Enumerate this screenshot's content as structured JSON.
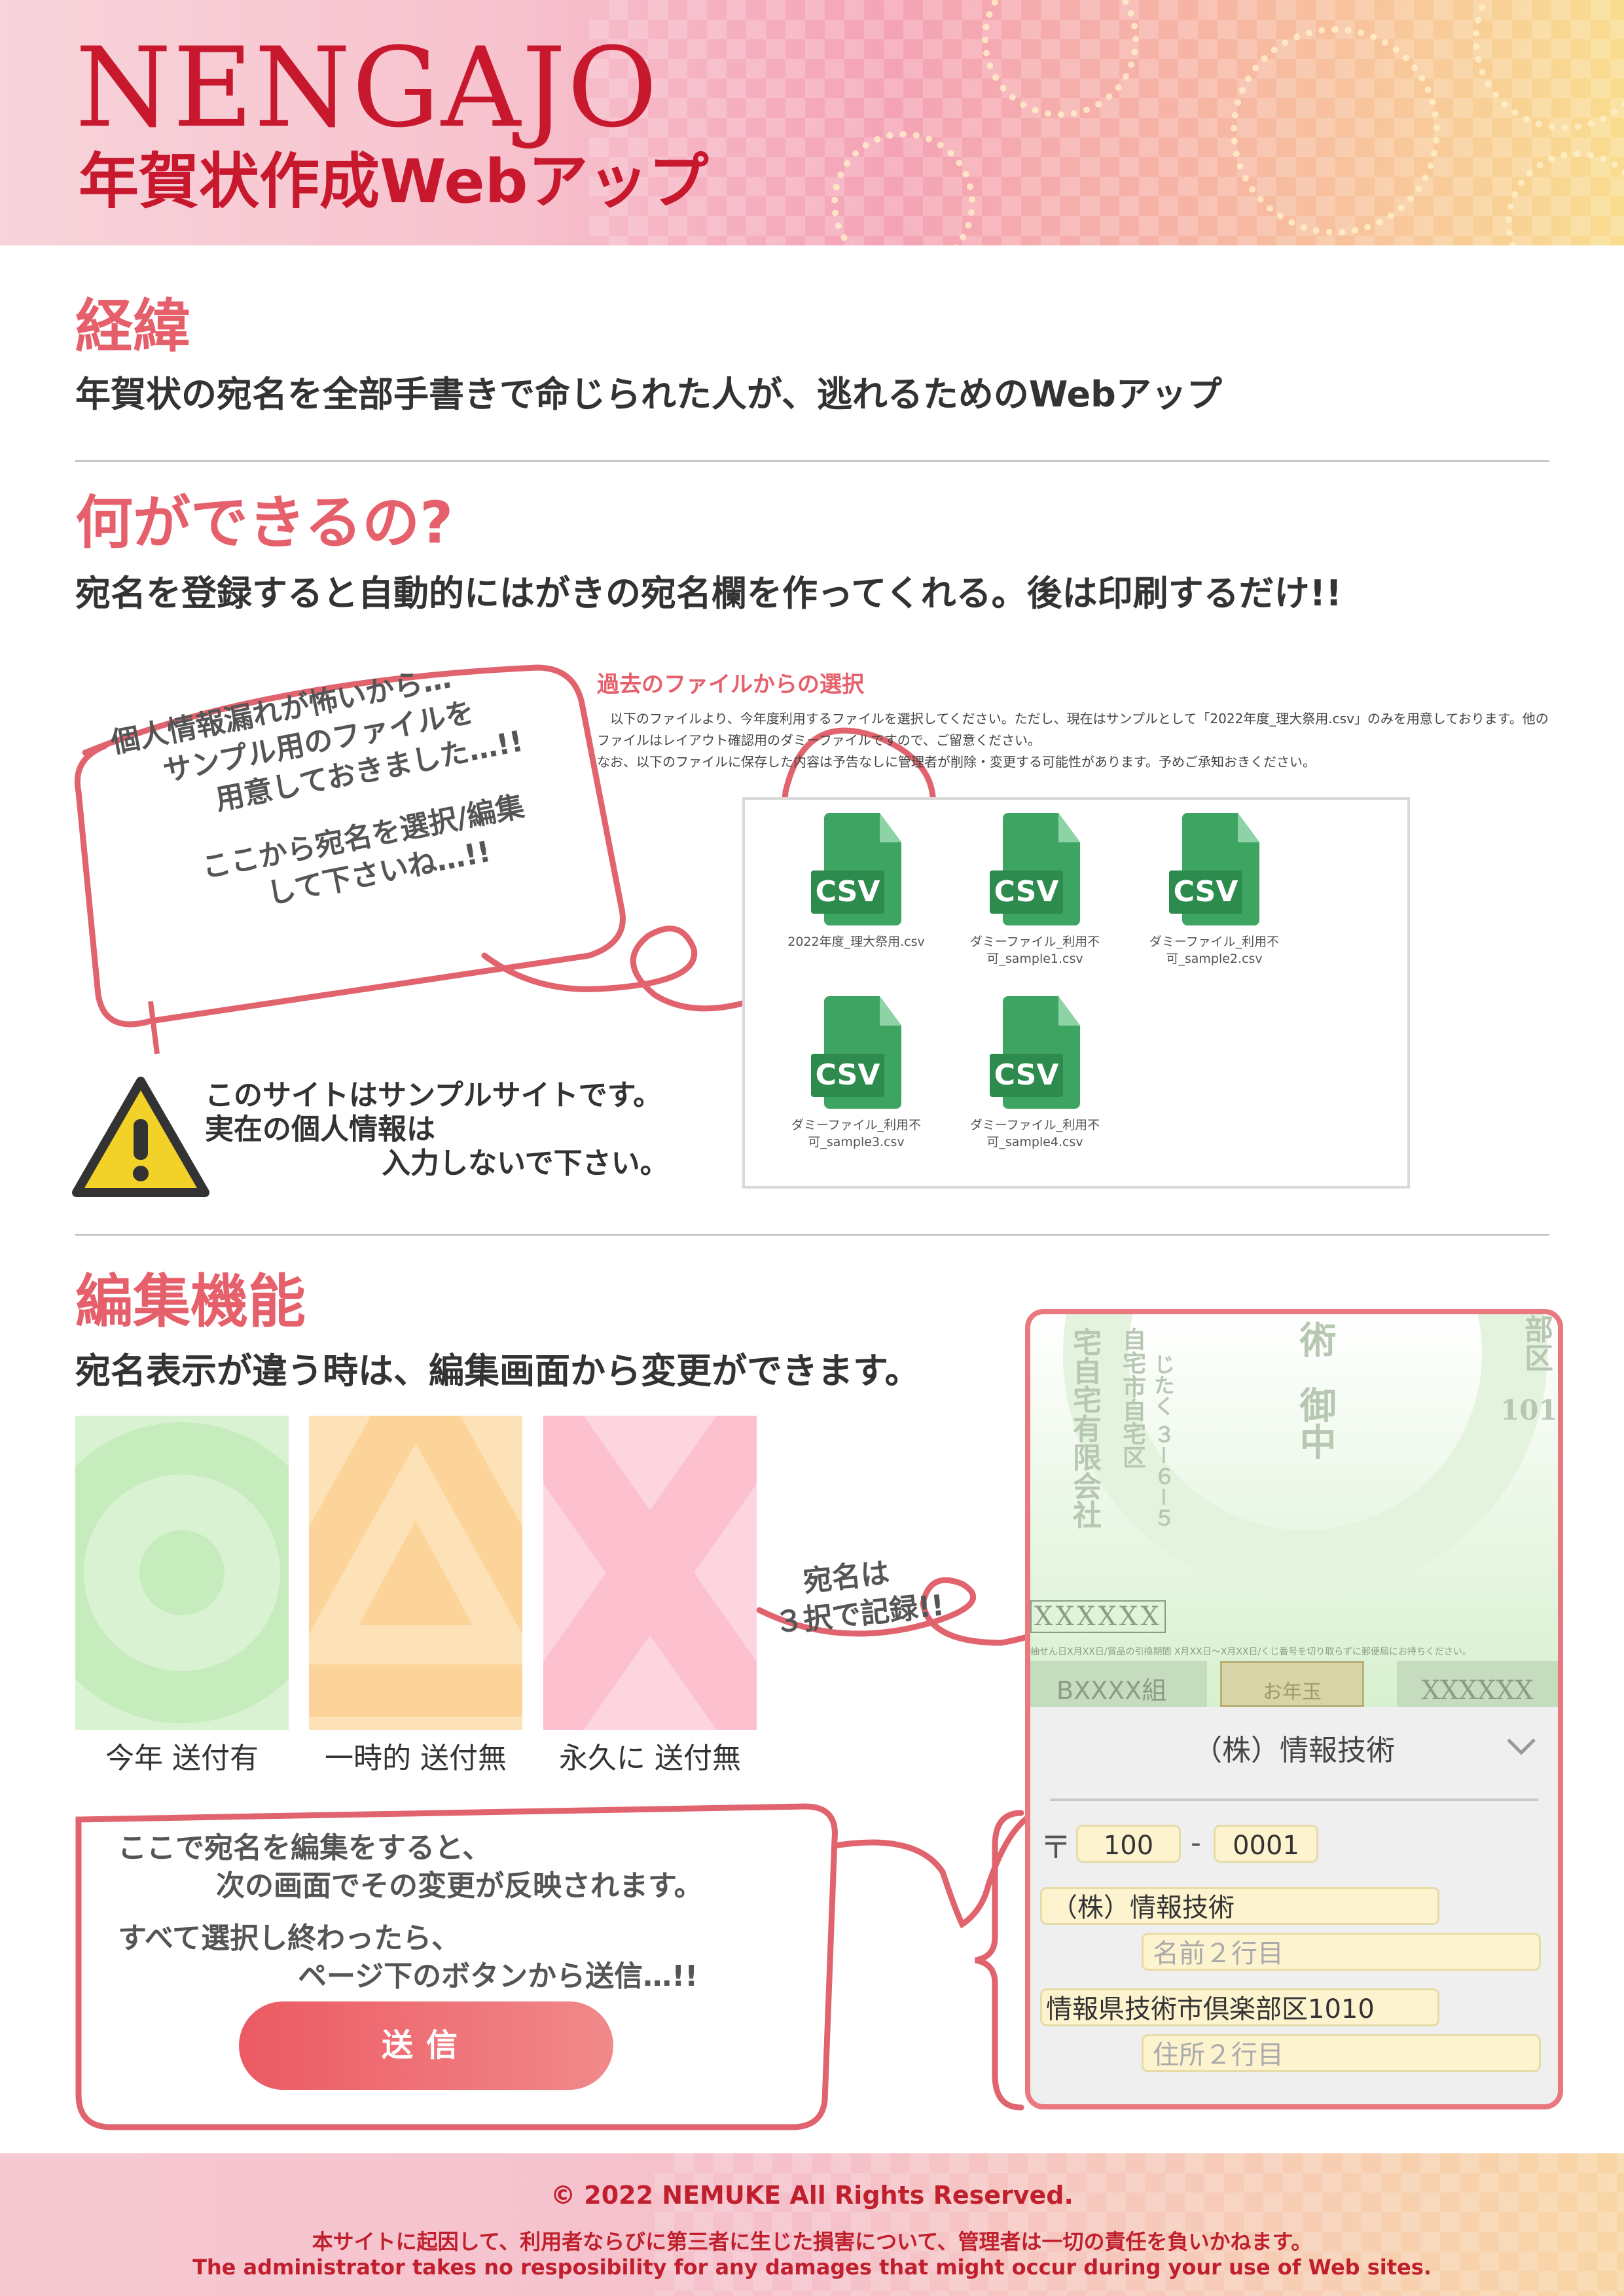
{
  "header": {
    "logo": "NENGAJO",
    "subtitle": "年賀状作成Webアップ"
  },
  "background": {
    "title": "経緯",
    "text": "年賀状の宛名を全部手書きで命じられた人が、逃れるためのWebアップ"
  },
  "features": {
    "title": "何ができるの?",
    "text": "宛名を登録すると自動的にはがきの宛名欄を作ってくれる。後は印刷するだけ!!"
  },
  "note1": {
    "line1": "個人情報漏れが怖いから…",
    "line2": "サンプル用のファイルを",
    "line3": "用意しておきました…!!",
    "line4": "ここから宛名を選択/編集",
    "line5": "して下さいね…!!"
  },
  "file_panel": {
    "title": "過去のファイルからの選択",
    "desc1": "　以下のファイルより、今年度利用するファイルを選択してください。ただし、現在はサンプルとして「2022年度_理大祭用.csv」のみを用意しております。他のファイルはレイアウト確認用のダミーファイルですので、ご留意ください。",
    "desc2": "なお、以下のファイルに保存した内容は予告なしに管理者が削除・変更する可能性があります。予めご承知おきください。",
    "icon_label": "CSV",
    "files": [
      {
        "name1": "2022年度_理大祭用.csv",
        "name2": ""
      },
      {
        "name1": "ダミーファイル_利用不",
        "name2": "可_sample1.csv"
      },
      {
        "name1": "ダミーファイル_利用不",
        "name2": "可_sample2.csv"
      },
      {
        "name1": "ダミーファイル_利用不",
        "name2": "可_sample3.csv"
      },
      {
        "name1": "ダミーファイル_利用不",
        "name2": "可_sample4.csv"
      }
    ]
  },
  "warning": {
    "line1": "このサイトはサンプルサイトです。",
    "line2": "実在の個人情報は",
    "line3": "入力しないで下さい。"
  },
  "edit": {
    "title": "編集機能",
    "text": "宛名表示が違う時は、編集画面から変更ができます。",
    "tiles": [
      "今年 送付有",
      "一時的 送付無",
      "永久に 送付無"
    ],
    "note_line1": "宛名は",
    "note_line2": "３択で記録!!"
  },
  "note2": {
    "line1": "ここで宛名を編集をすると、",
    "line2": "次の画面でその変更が反映されます。",
    "line3": "すべて選択し終わったら、",
    "line4": "ページ下のボタンから送信…!!"
  },
  "send_label": "送信",
  "phone": {
    "card_col1": "宅自宅有限会社",
    "card_col2": "自宅市自宅区",
    "card_col3": "じたく ３－６－５",
    "card_col4": "術",
    "card_col5": "御中",
    "card_col6": "部区",
    "card_num": "101",
    "card_stamps": "XXXXXX",
    "card_small": "抽せん日X月XX日/賞品の引換期間 X月XX日〜X月XX日/くじ番号を切り取らずに郵便局にお持ちください。",
    "card_left": "BXXXX組",
    "card_right": "XXXXXX",
    "card_mid": "お年玉",
    "select_value": "（株）情報技術",
    "postal_mark": "〒",
    "postal1": "100",
    "postal_sep": "-",
    "postal2": "0001",
    "name1": "（株）情報技術",
    "name2_ph": "名前２行目",
    "addr1": "情報県技術市倶楽部区1010",
    "addr2_ph": "住所２行目"
  },
  "footer": {
    "copyright": "© 2022 NEMUKE All Rights Reserved.",
    "disclaimer_ja": "本サイトに起因して、利用者ならびに第三者に生じた損害について、管理者は一切の責任を負いかねます。",
    "disclaimer_en": "The administrator takes no resposibility for any damages that might occur during your use of Web sites."
  }
}
